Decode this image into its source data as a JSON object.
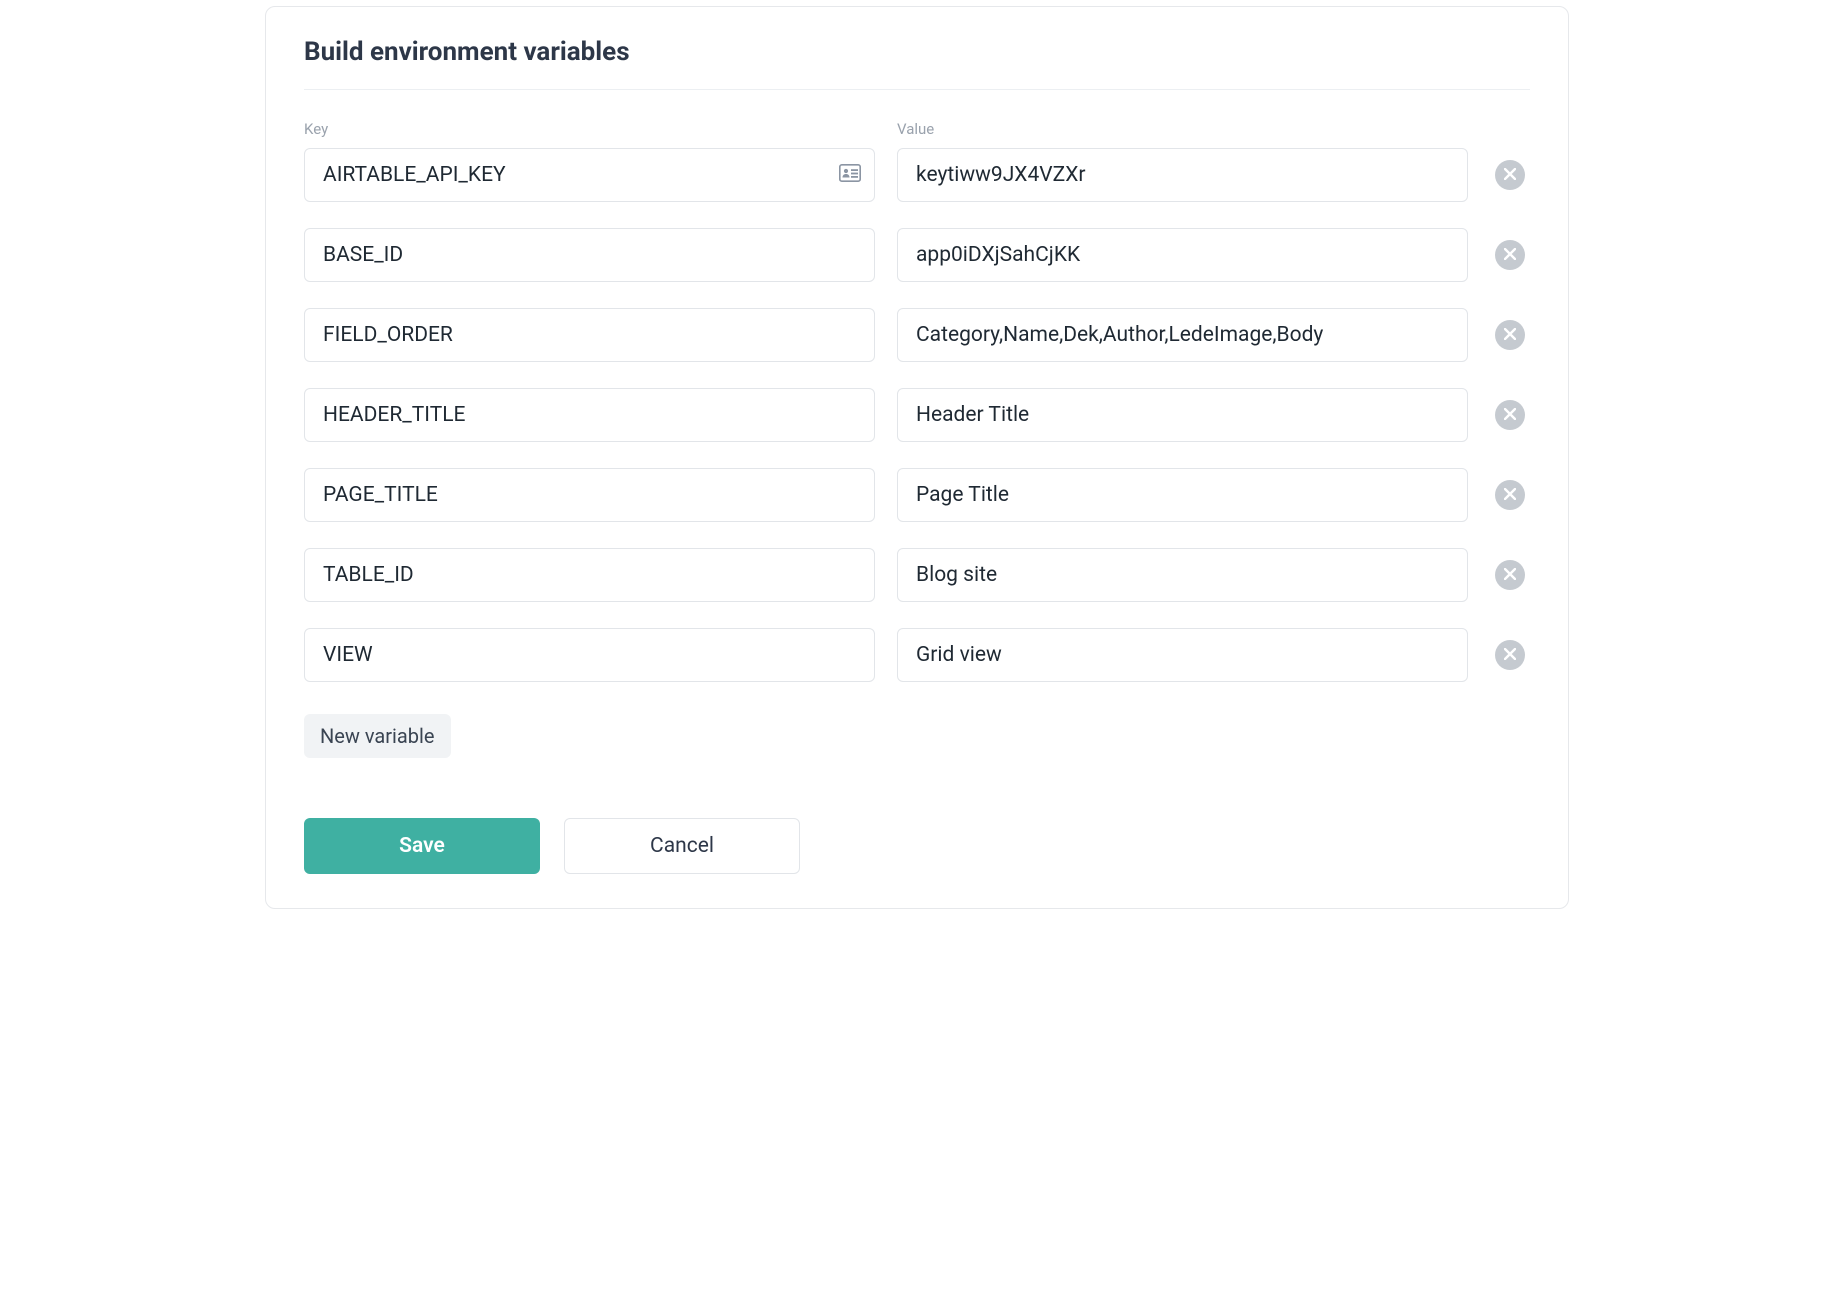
{
  "section": {
    "title": "Build environment variables",
    "columns": {
      "key": "Key",
      "value": "Value"
    },
    "rows": [
      {
        "key": "AIRTABLE_API_KEY",
        "value": "keytiww9JX4VZXr",
        "has_suffix_icon": true
      },
      {
        "key": "BASE_ID",
        "value": "app0iDXjSahCjKK"
      },
      {
        "key": "FIELD_ORDER",
        "value": "Category,Name,Dek,Author,LedeImage,Body"
      },
      {
        "key": "HEADER_TITLE",
        "value": "Header Title"
      },
      {
        "key": "PAGE_TITLE",
        "value": "Page Title"
      },
      {
        "key": "TABLE_ID",
        "value": "Blog site"
      },
      {
        "key": "VIEW",
        "value": "Grid view"
      }
    ],
    "new_variable_label": "New variable",
    "save_label": "Save",
    "cancel_label": "Cancel"
  }
}
